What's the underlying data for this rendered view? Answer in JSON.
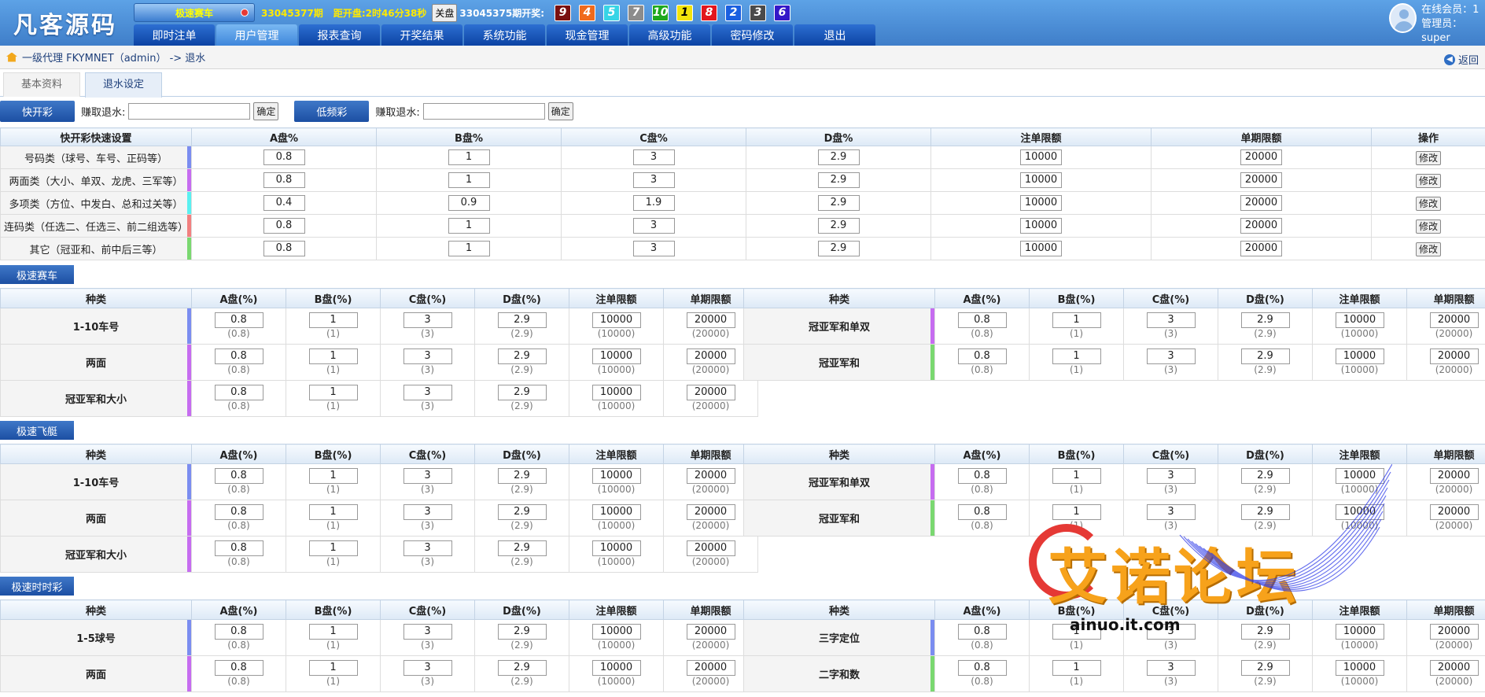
{
  "header": {
    "logo": "凡客源码",
    "game_button": "极速赛车",
    "period_label": "33045377期",
    "countdown_label": "距开盘:2时46分38秒",
    "close_label": "关盘",
    "last_period_label": "33045375期开奖:",
    "balls": [
      {
        "num": "9",
        "color": "#7a1010"
      },
      {
        "num": "4",
        "color": "#f06a1c"
      },
      {
        "num": "5",
        "color": "#37d4e6"
      },
      {
        "num": "7",
        "color": "#8c8c8c"
      },
      {
        "num": "10",
        "color": "#1ea81e"
      },
      {
        "num": "1",
        "color": "#f2e40c"
      },
      {
        "num": "8",
        "color": "#e3161e"
      },
      {
        "num": "2",
        "color": "#1a5fe0"
      },
      {
        "num": "3",
        "color": "#4a4a4a"
      },
      {
        "num": "6",
        "color": "#3418c8"
      }
    ],
    "nav": [
      "即时注单",
      "用户管理",
      "报表查询",
      "开奖结果",
      "系统功能",
      "现金管理",
      "高级功能",
      "密码修改",
      "退出"
    ],
    "active_nav": "用户管理",
    "online_label": "在线会员：1",
    "admin_label": "管理员：super"
  },
  "breadcrumb": {
    "path": "一级代理 FKYMNET（admin） -> 退水",
    "back_label": "返回"
  },
  "tabs": [
    "基本资料",
    "退水设定"
  ],
  "quickbar": {
    "fast_label": "快开彩",
    "slow_label": "低频彩",
    "earn_label": "赚取退水:",
    "confirm_label": "确定"
  },
  "quick_table": {
    "headers": [
      "快开彩快速设置",
      "A盘%",
      "B盘%",
      "C盘%",
      "D盘%",
      "注单限额",
      "单期限额",
      "操作"
    ],
    "edit_label": "修改",
    "rows": [
      {
        "label": "号码类（球号、车号、正码等）",
        "color": "#7b8df0",
        "a": "0.8",
        "b": "1",
        "c": "3",
        "d": "2.9",
        "bet": "10000",
        "period": "20000"
      },
      {
        "label": "两面类（大小、单双、龙虎、三军等）",
        "color": "#c66cf0",
        "a": "0.8",
        "b": "1",
        "c": "3",
        "d": "2.9",
        "bet": "10000",
        "period": "20000"
      },
      {
        "label": "多项类（方位、中发白、总和过关等）",
        "color": "#5af0f0",
        "a": "0.4",
        "b": "0.9",
        "c": "1.9",
        "d": "2.9",
        "bet": "10000",
        "period": "20000"
      },
      {
        "label": "连码类（任选二、任选三、前二组选等）",
        "color": "#f28080",
        "a": "0.8",
        "b": "1",
        "c": "3",
        "d": "2.9",
        "bet": "10000",
        "period": "20000"
      },
      {
        "label": "其它（冠亚和、前中后三等）",
        "color": "#7ad870",
        "a": "0.8",
        "b": "1",
        "c": "3",
        "d": "2.9",
        "bet": "10000",
        "period": "20000"
      }
    ]
  },
  "section_headers": [
    "种类",
    "A盘(%)",
    "B盘(%)",
    "C盘(%)",
    "D盘(%)",
    "注单限额",
    "单期限额"
  ],
  "sections": [
    {
      "title": "极速赛车",
      "left": [
        {
          "label": "1-10车号",
          "color": "#7b8df0",
          "a": "0.8",
          "a_sub": "(0.8)",
          "b": "1",
          "b_sub": "(1)",
          "c": "3",
          "c_sub": "(3)",
          "d": "2.9",
          "d_sub": "(2.9)",
          "bet": "10000",
          "bet_sub": "(10000)",
          "period": "20000",
          "period_sub": "(20000)"
        },
        {
          "label": "两面",
          "color": "#c66cf0",
          "a": "0.8",
          "a_sub": "(0.8)",
          "b": "1",
          "b_sub": "(1)",
          "c": "3",
          "c_sub": "(3)",
          "d": "2.9",
          "d_sub": "(2.9)",
          "bet": "10000",
          "bet_sub": "(10000)",
          "period": "20000",
          "period_sub": "(20000)"
        },
        {
          "label": "冠亚军和大小",
          "color": "#c66cf0",
          "a": "0.8",
          "a_sub": "(0.8)",
          "b": "1",
          "b_sub": "(1)",
          "c": "3",
          "c_sub": "(3)",
          "d": "2.9",
          "d_sub": "(2.9)",
          "bet": "10000",
          "bet_sub": "(10000)",
          "period": "20000",
          "period_sub": "(20000)"
        }
      ],
      "right": [
        {
          "label": "冠亚军和单双",
          "color": "#c66cf0",
          "a": "0.8",
          "a_sub": "(0.8)",
          "b": "1",
          "b_sub": "(1)",
          "c": "3",
          "c_sub": "(3)",
          "d": "2.9",
          "d_sub": "(2.9)",
          "bet": "10000",
          "bet_sub": "(10000)",
          "period": "20000",
          "period_sub": "(20000)"
        },
        {
          "label": "冠亚军和",
          "color": "#7ad870",
          "a": "0.8",
          "a_sub": "(0.8)",
          "b": "1",
          "b_sub": "(1)",
          "c": "3",
          "c_sub": "(3)",
          "d": "2.9",
          "d_sub": "(2.9)",
          "bet": "10000",
          "bet_sub": "(10000)",
          "period": "20000",
          "period_sub": "(20000)"
        }
      ]
    },
    {
      "title": "极速飞艇",
      "left": [
        {
          "label": "1-10车号",
          "color": "#7b8df0",
          "a": "0.8",
          "a_sub": "(0.8)",
          "b": "1",
          "b_sub": "(1)",
          "c": "3",
          "c_sub": "(3)",
          "d": "2.9",
          "d_sub": "(2.9)",
          "bet": "10000",
          "bet_sub": "(10000)",
          "period": "20000",
          "period_sub": "(20000)"
        },
        {
          "label": "两面",
          "color": "#c66cf0",
          "a": "0.8",
          "a_sub": "(0.8)",
          "b": "1",
          "b_sub": "(1)",
          "c": "3",
          "c_sub": "(3)",
          "d": "2.9",
          "d_sub": "(2.9)",
          "bet": "10000",
          "bet_sub": "(10000)",
          "period": "20000",
          "period_sub": "(20000)"
        },
        {
          "label": "冠亚军和大小",
          "color": "#c66cf0",
          "a": "0.8",
          "a_sub": "(0.8)",
          "b": "1",
          "b_sub": "(1)",
          "c": "3",
          "c_sub": "(3)",
          "d": "2.9",
          "d_sub": "(2.9)",
          "bet": "10000",
          "bet_sub": "(10000)",
          "period": "20000",
          "period_sub": "(20000)"
        }
      ],
      "right": [
        {
          "label": "冠亚军和单双",
          "color": "#c66cf0",
          "a": "0.8",
          "a_sub": "(0.8)",
          "b": "1",
          "b_sub": "(1)",
          "c": "3",
          "c_sub": "(3)",
          "d": "2.9",
          "d_sub": "(2.9)",
          "bet": "10000",
          "bet_sub": "(10000)",
          "period": "20000",
          "period_sub": "(20000)"
        },
        {
          "label": "冠亚军和",
          "color": "#7ad870",
          "a": "0.8",
          "a_sub": "(0.8)",
          "b": "1",
          "b_sub": "(1)",
          "c": "3",
          "c_sub": "(3)",
          "d": "2.9",
          "d_sub": "(2.9)",
          "bet": "10000",
          "bet_sub": "(10000)",
          "period": "20000",
          "period_sub": "(20000)"
        }
      ]
    },
    {
      "title": "极速时时彩",
      "left": [
        {
          "label": "1-5球号",
          "color": "#7b8df0",
          "a": "0.8",
          "a_sub": "(0.8)",
          "b": "1",
          "b_sub": "(1)",
          "c": "3",
          "c_sub": "(3)",
          "d": "2.9",
          "d_sub": "(2.9)",
          "bet": "10000",
          "bet_sub": "(10000)",
          "period": "20000",
          "period_sub": "(20000)"
        },
        {
          "label": "两面",
          "color": "#c66cf0",
          "a": "0.8",
          "a_sub": "(0.8)",
          "b": "1",
          "b_sub": "(1)",
          "c": "3",
          "c_sub": "(3)",
          "d": "2.9",
          "d_sub": "(2.9)",
          "bet": "10000",
          "bet_sub": "(10000)",
          "period": "20000",
          "period_sub": "(20000)"
        }
      ],
      "right": [
        {
          "label": "三字定位",
          "color": "#7b8df0",
          "a": "0.8",
          "a_sub": "(0.8)",
          "b": "1",
          "b_sub": "(1)",
          "c": "3",
          "c_sub": "(3)",
          "d": "2.9",
          "d_sub": "(2.9)",
          "bet": "10000",
          "bet_sub": "(10000)",
          "period": "20000",
          "period_sub": "(20000)"
        },
        {
          "label": "二字和数",
          "color": "#7ad870",
          "a": "0.8",
          "a_sub": "(0.8)",
          "b": "1",
          "b_sub": "(1)",
          "c": "3",
          "c_sub": "(3)",
          "d": "2.9",
          "d_sub": "(2.9)",
          "bet": "10000",
          "bet_sub": "(10000)",
          "period": "20000",
          "period_sub": "(20000)"
        }
      ]
    }
  ],
  "watermark": {
    "text": "艾诺论坛",
    "url": "ainuo.it.com"
  }
}
